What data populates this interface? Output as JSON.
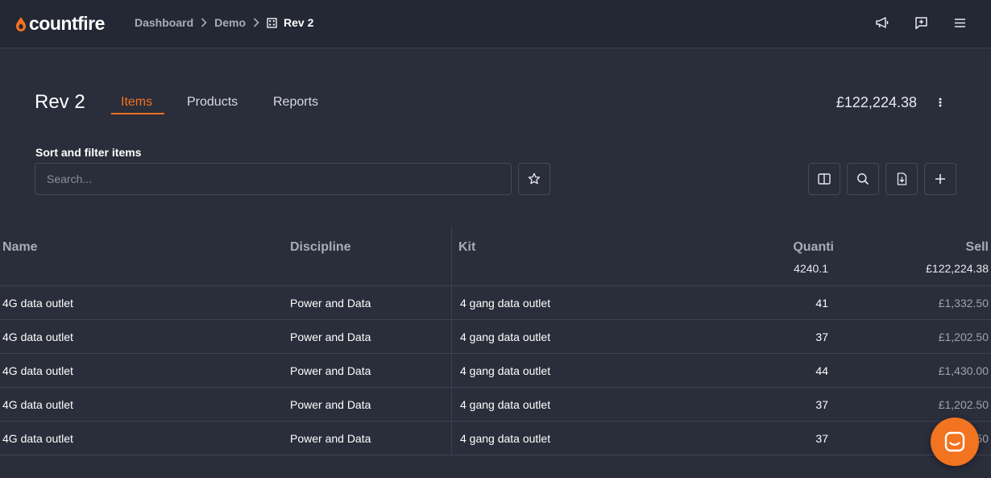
{
  "brand": {
    "name": "countfire",
    "accent": "#f27320"
  },
  "breadcrumb": [
    "Dashboard",
    "Demo",
    "Rev 2"
  ],
  "page": {
    "title": "Rev 2",
    "total": "£122,224.38"
  },
  "tabs": [
    {
      "label": "Items",
      "active": true
    },
    {
      "label": "Products",
      "active": false
    },
    {
      "label": "Reports",
      "active": false
    }
  ],
  "filter": {
    "label": "Sort and filter items",
    "search_placeholder": "Search..."
  },
  "toolbar_icons": [
    "star-icon",
    "columns-icon",
    "search-icon",
    "export-file-icon",
    "plus-icon"
  ],
  "top_icons": [
    "megaphone-icon",
    "feedback-icon",
    "menu-icon"
  ],
  "table": {
    "columns": [
      "Name",
      "Discipline",
      "Kit",
      "Quanti",
      "Sell"
    ],
    "totals": {
      "quantity": "4240.1",
      "sell": "£122,224.38"
    },
    "rows": [
      {
        "name": "4G data outlet",
        "discipline": "Power and Data",
        "kit": "4 gang data outlet",
        "quantity": "41",
        "sell": "£1,332.50"
      },
      {
        "name": "4G data outlet",
        "discipline": "Power and Data",
        "kit": "4 gang data outlet",
        "quantity": "37",
        "sell": "£1,202.50"
      },
      {
        "name": "4G data outlet",
        "discipline": "Power and Data",
        "kit": "4 gang data outlet",
        "quantity": "44",
        "sell": "£1,430.00"
      },
      {
        "name": "4G data outlet",
        "discipline": "Power and Data",
        "kit": "4 gang data outlet",
        "quantity": "37",
        "sell": "£1,202.50"
      },
      {
        "name": "4G data outlet",
        "discipline": "Power and Data",
        "kit": "4 gang data outlet",
        "quantity": "37",
        "sell": "£1,202.50"
      }
    ]
  }
}
